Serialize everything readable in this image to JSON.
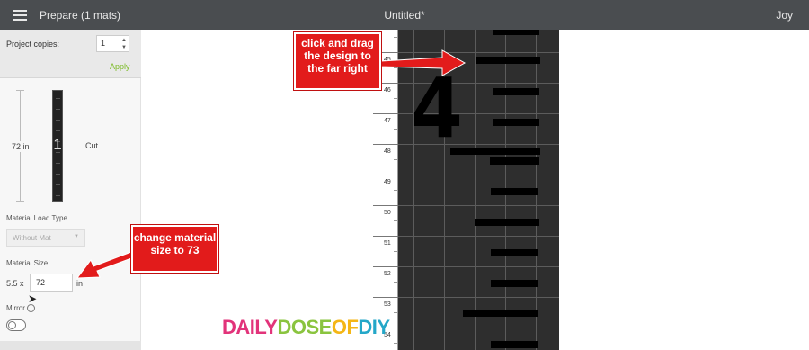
{
  "topbar": {
    "app_title": "Prepare (1 mats)",
    "doc_title": "Untitled*",
    "user_name": "Joy"
  },
  "sidebar": {
    "copies_label": "Project copies:",
    "copies_value": "1",
    "apply_label": "Apply",
    "mat_length_label": "72 in",
    "mat_number": "1",
    "cut_label": "Cut",
    "load_type_label": "Material Load Type",
    "load_type_value": "Without Mat",
    "material_size_label": "Material Size",
    "material_width": "5.5 x",
    "material_height": "72",
    "material_unit": "in",
    "mirror_label": "Mirror",
    "mirror_on": false
  },
  "ruler": {
    "labels": [
      "45",
      "46",
      "47",
      "48",
      "49",
      "50",
      "51",
      "52",
      "53",
      "54"
    ]
  },
  "callouts": {
    "drag_design": "click and drag the design to the far right",
    "change_size": "change material size to 73"
  },
  "design": {
    "digit": "4"
  },
  "watermark": {
    "part1": "DAILY",
    "part2": "DOSE",
    "part3": "OF",
    "part4": "DIY"
  },
  "colors": {
    "topbar": "#4a4d50",
    "apply": "#7cbb26",
    "callout": "#e21b1b",
    "mat": "#2e2e2e"
  }
}
